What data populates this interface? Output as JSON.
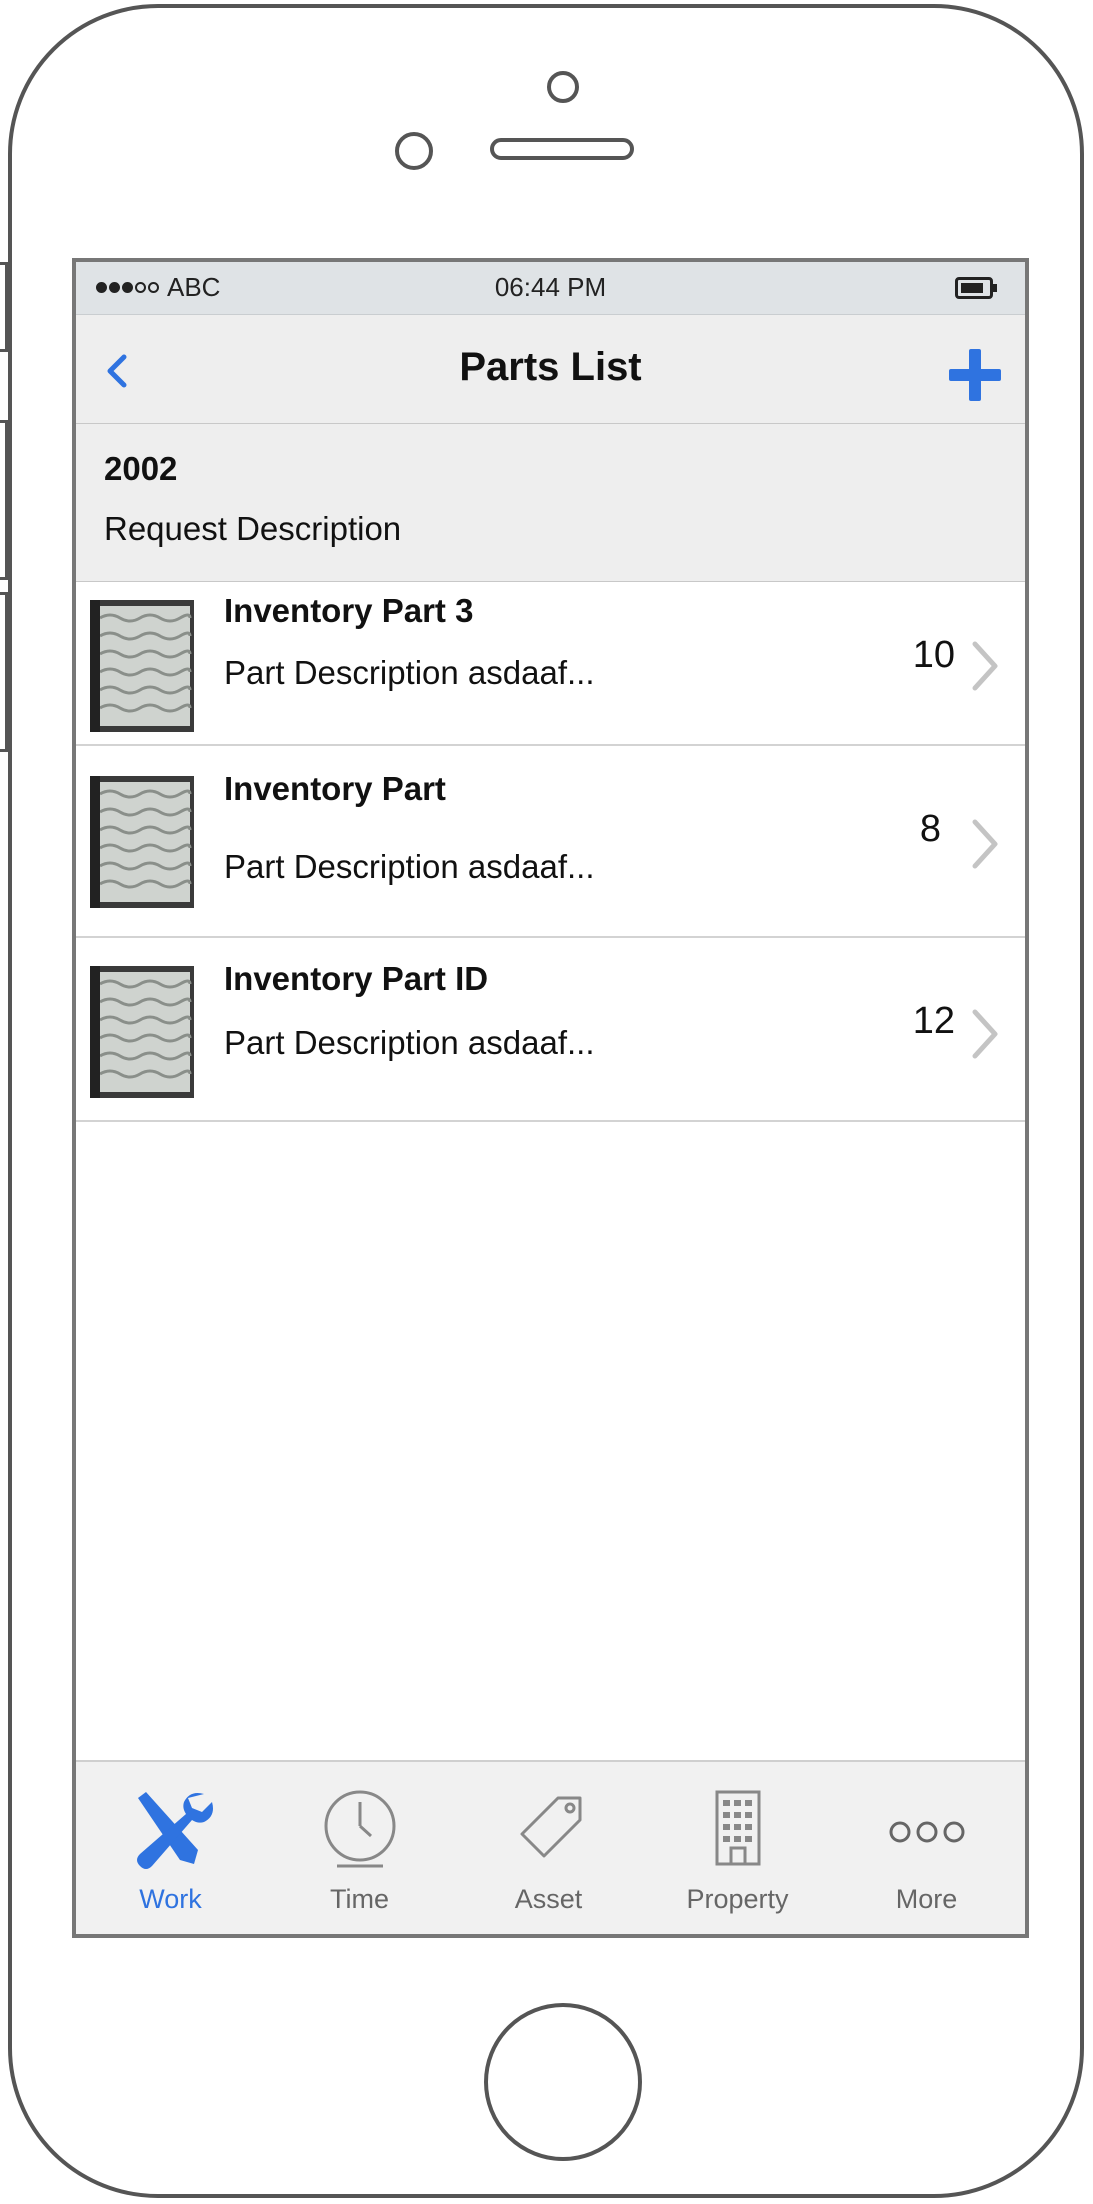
{
  "status_bar": {
    "carrier": "ABC",
    "time": "06:44 PM"
  },
  "nav": {
    "title": "Parts List",
    "back_icon": "chevron-left-icon",
    "add_icon": "plus-icon",
    "accent_color": "#2f73e0"
  },
  "request": {
    "id": "2002",
    "description": "Request Description"
  },
  "parts": [
    {
      "title": "Inventory Part 3",
      "description": "Part Description asdaaf...",
      "quantity": "10"
    },
    {
      "title": "Inventory Part",
      "description": "Part Description asdaaf...",
      "quantity": "8"
    },
    {
      "title": "Inventory Part ID",
      "description": "Part Description asdaaf...",
      "quantity": "12"
    }
  ],
  "tabs": [
    {
      "label": "Work",
      "icon": "wrench-screwdriver-icon",
      "active": true
    },
    {
      "label": "Time",
      "icon": "clock-icon",
      "active": false
    },
    {
      "label": "Asset",
      "icon": "tag-icon",
      "active": false
    },
    {
      "label": "Property",
      "icon": "building-icon",
      "active": false
    },
    {
      "label": "More",
      "icon": "more-dots-icon",
      "active": false
    }
  ]
}
